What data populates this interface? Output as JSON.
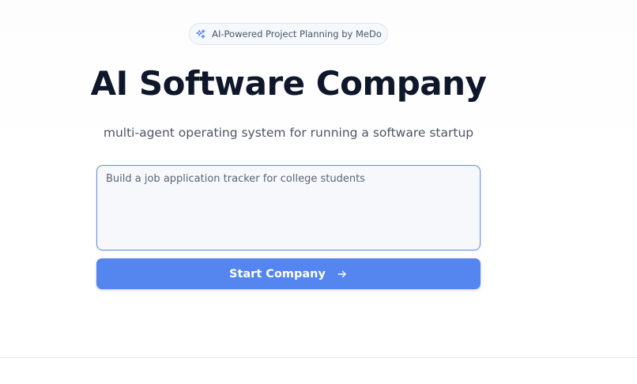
{
  "hero": {
    "badge_text": "AI-Powered Project Planning by MeDo",
    "badge_icon": "sparkles-icon",
    "title": "AI Software Company",
    "subtitle": "multi-agent operating system for running a software startup"
  },
  "prompt": {
    "value": "",
    "placeholder": "Build a job application tracker for college students"
  },
  "start_button": {
    "label": "Start Company",
    "icon": "arrow-right-icon",
    "color": "#5585ef"
  },
  "colors": {
    "accent": "#5585ef",
    "input_border": "#6f93e6",
    "title": "#0f172a"
  }
}
